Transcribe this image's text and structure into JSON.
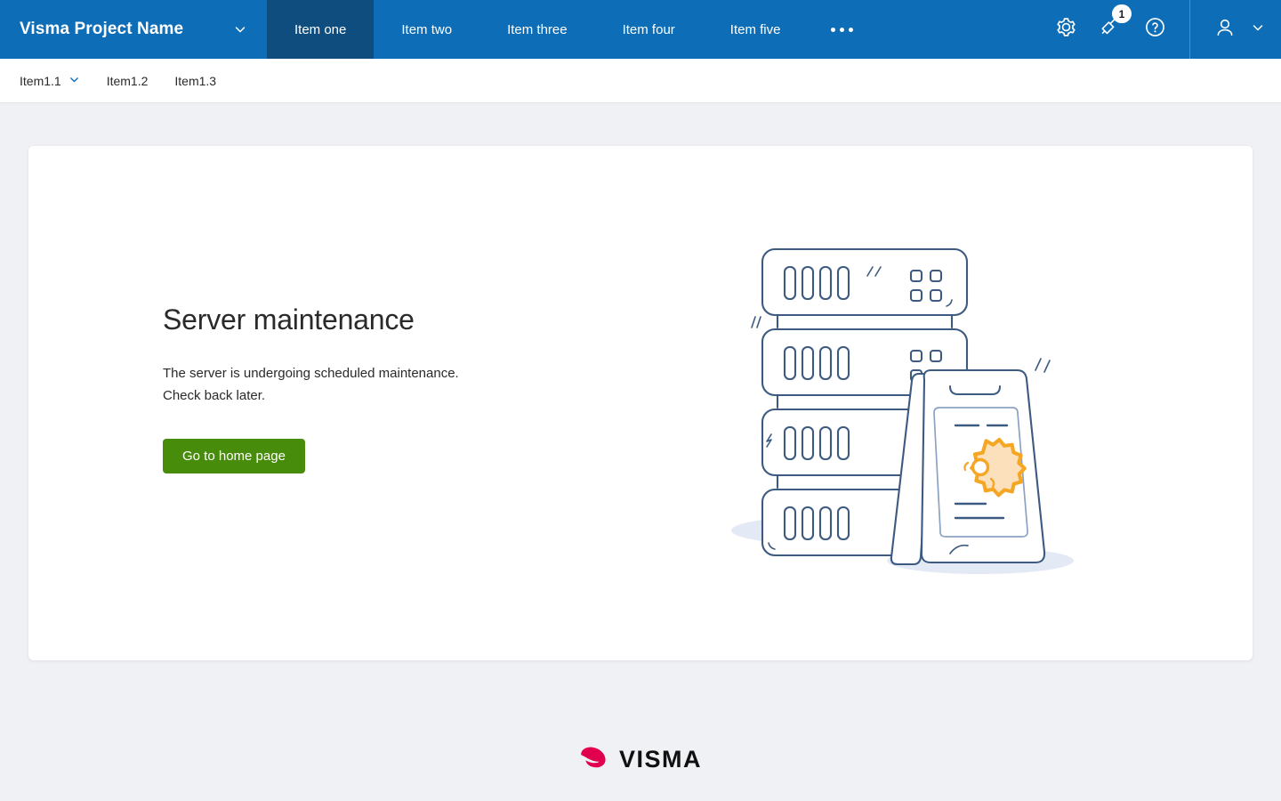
{
  "header": {
    "brand": "Visma Project Name",
    "brand_chevron_icon": "chevron-down-icon",
    "tabs": [
      {
        "label": "Item one",
        "active": true
      },
      {
        "label": "Item two",
        "active": false
      },
      {
        "label": "Item three",
        "active": false
      },
      {
        "label": "Item four",
        "active": false
      },
      {
        "label": "Item five",
        "active": false
      }
    ],
    "overflow_icon": "ellipsis-icon",
    "actions": [
      {
        "icon": "gear-icon",
        "label": "Settings"
      },
      {
        "icon": "megaphone-icon",
        "label": "Notifications",
        "badge": "1"
      },
      {
        "icon": "help-icon",
        "label": "Help"
      }
    ],
    "user": {
      "avatar_icon": "user-avatar-icon",
      "chevron_icon": "chevron-down-icon"
    },
    "colors": {
      "background": "#0d6db7",
      "active_tab": "#0e4d7e",
      "text": "#ffffff"
    }
  },
  "subnav": {
    "items": [
      {
        "label": "Item1.1",
        "has_chevron": true
      },
      {
        "label": "Item1.2",
        "has_chevron": false
      },
      {
        "label": "Item1.3",
        "has_chevron": false
      }
    ]
  },
  "main": {
    "title": "Server maintenance",
    "description_line1": "The server is undergoing scheduled maintenance.",
    "description_line2": "Check back later.",
    "cta_label": "Go to home page",
    "cta_color": "#478c0a",
    "illustration_name": "server-maintenance-illustration",
    "illustration_parts": {
      "server_units": 4,
      "sign": "a-frame-maintenance-sign",
      "gear_color": "#f5a623"
    }
  },
  "footer": {
    "logo_mark_icon": "visma-swoosh-icon",
    "logo_text": "VISMA",
    "logo_mark_color": "#e0004d"
  },
  "page": {
    "background": "#f0f1f4",
    "card_background": "#ffffff"
  }
}
